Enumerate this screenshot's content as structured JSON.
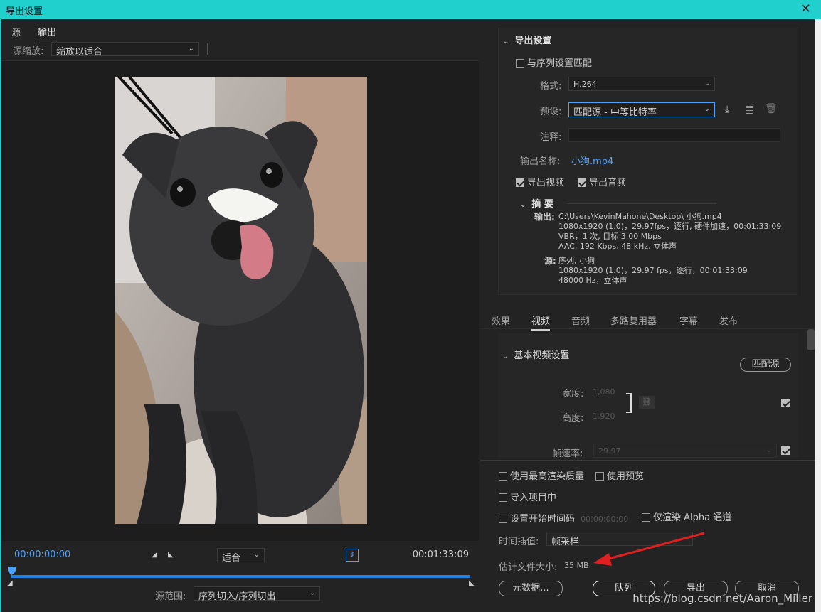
{
  "title": "导出设置",
  "left": {
    "tabs": [
      "源",
      "输出"
    ],
    "source_zoom_label": "源缩放:",
    "source_zoom_value": "缩放以适合",
    "timecode_start": "00:00:00:00",
    "timecode_end": "00:01:33:09",
    "fit_value": "适合",
    "source_range_label": "源范围:",
    "source_range_value": "序列切入/序列切出"
  },
  "export_settings": {
    "section_title": "导出设置",
    "match_sequence_label": "与序列设置匹配",
    "match_sequence_checked": false,
    "format_label": "格式:",
    "format_value": "H.264",
    "preset_label": "预设:",
    "preset_value": "匹配源 - 中等比特率",
    "comment_label": "注释:",
    "comment_value": "",
    "output_name_label": "输出名称:",
    "output_name_value": "小狗.mp4",
    "export_video_label": "导出视频",
    "export_video_checked": true,
    "export_audio_label": "导出音频",
    "export_audio_checked": true
  },
  "summary": {
    "title": "摘 要",
    "output_label": "输出:",
    "output_lines": [
      "C:\\Users\\KevinMahone\\Desktop\\ 小狗.mp4",
      "1080x1920 (1.0)，29.97fps，逐行, 硬件加速，00:01:33:09",
      "VBR，1 次, 目标 3.00 Mbps",
      "AAC, 192 Kbps, 48  kHz, 立体声"
    ],
    "source_label": "源:",
    "source_lines": [
      "序列, 小狗",
      "1080x1920 (1.0)，29.97 fps，逐行，00:01:33:09",
      "48000 Hz，立体声"
    ]
  },
  "tabs": [
    "效果",
    "视频",
    "音频",
    "多路复用器",
    "字幕",
    "发布"
  ],
  "active_tab": "视频",
  "video": {
    "section_title": "基本视频设置",
    "match_source_button": "匹配源",
    "width_label": "宽度:",
    "width_value": "1,080",
    "height_label": "高度:",
    "height_value": "1,920",
    "framerate_label": "帧速率:",
    "framerate_value": "29.97"
  },
  "bottom": {
    "max_render_quality": "使用最高渲染质量",
    "use_previews": "使用预览",
    "import_into_project": "导入项目中",
    "set_start_timecode": "设置开始时间码",
    "start_timecode_value": "00;00;00;00",
    "render_alpha_only": "仅渲染 Alpha 通道",
    "time_interp_label": "时间插值:",
    "time_interp_value": "帧采样",
    "est_size_label": "估计文件大小:",
    "est_size_value": "35 MB",
    "metadata_button": "元数据...",
    "queue_button": "队列",
    "export_button": "导出",
    "cancel_button": "取消"
  },
  "watermark": "https://blog.csdn.net/Aaron_Miller",
  "colors": {
    "titlebar": "#1fd0cd",
    "accent_blue": "#4aa3ff",
    "arrow_red": "#e02020"
  }
}
